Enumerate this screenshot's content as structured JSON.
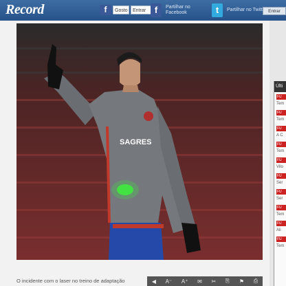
{
  "header": {
    "logo": "Record",
    "facebook_gadget": "f",
    "btn_gosto": "Gosto",
    "btn_entrar": "Entrar",
    "facebook_text": "Partilhar no Facebook",
    "twitter_text": "Partilhar no Twitter",
    "facebook_icon_glyph": "f",
    "twitter_icon_glyph": "t",
    "login": "Entrar"
  },
  "photo": {
    "shirt_text": "SAGRES"
  },
  "caption": "O incidente com o laser no treino de adaptação",
  "toolbar": {
    "icons": [
      "◀",
      "A⁻",
      "A⁺",
      "✉",
      "✂",
      "⎘",
      "⚑",
      "⎙"
    ]
  },
  "sidebar": {
    "head": "Últi",
    "items": [
      {
        "tag": "FU",
        "title": "Tem"
      },
      {
        "tag": "FU",
        "title": "Tem"
      },
      {
        "tag": "FU",
        "title": "A C"
      },
      {
        "tag": "FU",
        "title": "Tem"
      },
      {
        "tag": "FU",
        "title": "Vilo"
      },
      {
        "tag": "FU",
        "title": "Ser"
      },
      {
        "tag": "FU",
        "title": "Ser"
      },
      {
        "tag": "FU",
        "title": "Tem"
      },
      {
        "tag": "FU",
        "title": "Ali"
      },
      {
        "tag": "FU",
        "title": "Tem"
      }
    ]
  },
  "colors": {
    "header_blue": "#2f5e96",
    "facebook_blue": "#3b5998",
    "twitter_blue": "#33ccff",
    "tag_red": "#cc2222"
  }
}
